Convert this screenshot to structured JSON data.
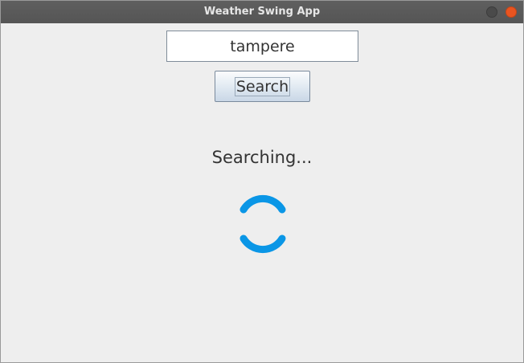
{
  "window": {
    "title": "Weather Swing App"
  },
  "search": {
    "value": "tampere",
    "button_label": "Search"
  },
  "status": {
    "text": "Searching..."
  },
  "colors": {
    "spinner": "#0a96e6",
    "close_button": "#e95420",
    "background": "#eeeeee"
  }
}
